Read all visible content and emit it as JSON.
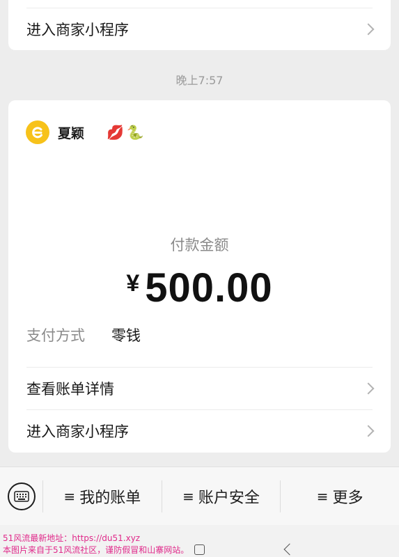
{
  "top_card": {
    "row_label": "进入商家小程序"
  },
  "timestamp": "晚上7:57",
  "merchant": {
    "name": "夏颖",
    "emoji": "💋🐍"
  },
  "payment": {
    "amount_label": "付款金额",
    "currency": "¥",
    "amount": "500.00",
    "method_label": "支付方式",
    "method_value": "零钱"
  },
  "actions": {
    "bill_detail": "查看账单详情",
    "merchant_miniprogram": "进入商家小程序"
  },
  "menu": {
    "items": [
      {
        "label": "我的账单"
      },
      {
        "label": "账户安全"
      },
      {
        "label": "更多"
      }
    ],
    "hamburger_glyph": "≡"
  },
  "watermark": {
    "line1": "51风流最新地址：https://du51.xyz",
    "line2": "本图片来自于51风流社区，谨防假冒和山寨网站。"
  },
  "colors": {
    "background": "#ededed",
    "card": "#ffffff",
    "logo": "#f7c21a",
    "watermark": "#e0298a"
  }
}
